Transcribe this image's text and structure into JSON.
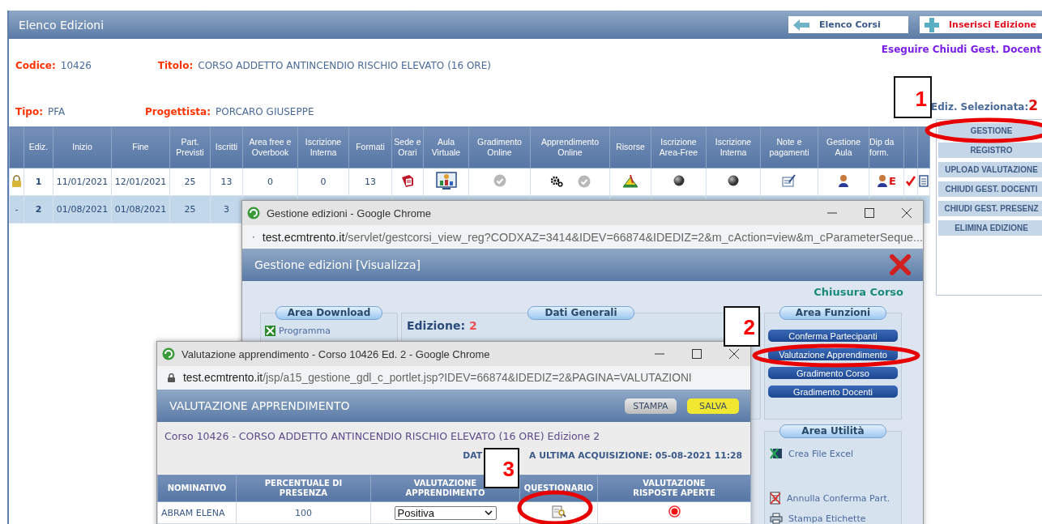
{
  "main": {
    "title": "Elenco Edizioni",
    "nav_buttons": [
      {
        "kind": "back",
        "label": "Elenco Corsi"
      },
      {
        "kind": "add",
        "label": "Inserisci Edizione"
      }
    ],
    "notice": "Eseguire Chiudi Gest. Docent",
    "fields": [
      {
        "label": "Codice:",
        "value": "10426"
      },
      {
        "label": "Titolo:",
        "value": "CORSO ADDETTO ANTINCENDIO RISCHIO ELEVATO (16 ORE)"
      },
      {
        "label": "Tipo:",
        "value": "PFA"
      },
      {
        "label": "Progettista:",
        "value": "PORCARO GIUSEPPE"
      }
    ],
    "selected_label": "Ediz. Selezionata:",
    "selected_value": "2",
    "table": {
      "columns": [
        {
          "kind": "blank"
        },
        {
          "kind": "text",
          "label": "Ediz."
        },
        {
          "kind": "text",
          "label": "Inizio"
        },
        {
          "kind": "text",
          "label": "Fine"
        },
        {
          "kind": "text",
          "label": "Part. Previsti"
        },
        {
          "kind": "text",
          "label": "Iscritti"
        },
        {
          "kind": "text",
          "label": "Area free e Overbook"
        },
        {
          "kind": "text",
          "label": "Iscrizione Interna"
        },
        {
          "kind": "text",
          "label": "Formati"
        },
        {
          "kind": "text",
          "label": "Sede e Orari"
        },
        {
          "kind": "text",
          "label": "Aula Virtuale"
        },
        {
          "kind": "text",
          "label": "Gradimento Online"
        },
        {
          "kind": "text",
          "label": "Apprendimento Online"
        },
        {
          "kind": "text",
          "label": "Risorse"
        },
        {
          "kind": "text",
          "label": "Iscrizione Area-Free"
        },
        {
          "kind": "text",
          "label": "Iscrizione Interna"
        },
        {
          "kind": "text",
          "label": "Note e pagamenti"
        },
        {
          "kind": "text",
          "label": "Gestione Aula"
        },
        {
          "kind": "text",
          "label": "Dip da form."
        },
        {
          "kind": "blank"
        },
        {
          "kind": "blank"
        }
      ],
      "rows": [
        {
          "selected": false,
          "cells": [
            {
              "kind": "icon"
            },
            {
              "kind": "text",
              "text": "1"
            },
            {
              "kind": "text",
              "text": "11/01/2021"
            },
            {
              "kind": "text",
              "text": "12/01/2021"
            },
            {
              "kind": "text",
              "text": "25"
            },
            {
              "kind": "text",
              "text": "13"
            },
            {
              "kind": "text",
              "text": "0"
            },
            {
              "kind": "text",
              "text": "0"
            },
            {
              "kind": "text",
              "text": "13"
            },
            {
              "kind": "icon"
            },
            {
              "kind": "icon"
            },
            {
              "kind": "icon"
            },
            {
              "kind": "icon"
            },
            {
              "kind": "icon"
            },
            {
              "kind": "icon"
            },
            {
              "kind": "icon"
            },
            {
              "kind": "icon"
            },
            {
              "kind": "icon"
            },
            {
              "kind": "icon",
              "text": "E"
            },
            {
              "kind": "icon"
            },
            {
              "kind": "icon"
            }
          ]
        },
        {
          "selected": true,
          "cells": [
            {
              "kind": "text",
              "text": "-"
            },
            {
              "kind": "text",
              "text": "2"
            },
            {
              "kind": "text",
              "text": "01/08/2021"
            },
            {
              "kind": "text",
              "text": "01/08/2021"
            },
            {
              "kind": "text",
              "text": "25"
            },
            {
              "kind": "text",
              "text": "3"
            }
          ]
        }
      ]
    },
    "menu": [
      "GESTIONE",
      "REGISTRO",
      "UPLOAD VALUTAZIONE",
      "CHIUDI GEST. DOCENTI",
      "CHIUDI GEST. PRESENZ",
      "ELIMINA EDIZIONE"
    ]
  },
  "window_1": {
    "title": "Gestione edizioni - Google Chrome",
    "url_host": "test.ecmtrento.it",
    "url_path": "/servlet/gestcorsi_view_reg?CODXAZ=3414&IDEV=66874&IDEDIZ=2&m_cAction=view&m_cParameterSeque...",
    "header": "Gestione edizioni [Visualizza]",
    "status": "Chiusura Corso",
    "download": {
      "title": "Area Download",
      "items": [
        "Programma"
      ]
    },
    "general": {
      "title": "Dati Generali",
      "label": "Edizione:",
      "value": "2"
    },
    "functions": {
      "title": "Area Funzioni",
      "buttons": [
        "Conferma Partecipanti",
        "Valutazione Apprendimento",
        "Gradimento Corso",
        "Gradimento Docenti"
      ]
    },
    "utilities": {
      "title": "Area Utilità",
      "items": [
        "Crea File Excel",
        "Annulla Conferma Part.",
        "Stampa Etichette"
      ]
    }
  },
  "window_2": {
    "title": "Valutazione apprendimento - Corso 10426 Ed. 2 - Google Chrome",
    "url_host": "test.ecmtrento.it",
    "url_path": "/jsp/a15_gestione_gdl_c_portlet.jsp?IDEV=66874&IDEDIZ=2&PAGINA=VALUTAZIONI",
    "header": "VALUTAZIONE APPRENDIMENTO",
    "buttons": [
      {
        "kind": "print",
        "label": "STAMPA"
      },
      {
        "kind": "save",
        "label": "SALVA"
      }
    ],
    "course": "Corso 10426 - CORSO ADDETTO ANTINCENDIO RISCHIO ELEVATO (16 ORE) Edizione 2",
    "acquisition": [
      "DAT",
      "A ULTIMA ACQUISIZIONE: 05-08-2021 11:28"
    ],
    "table": {
      "columns": [
        "NOMINATIVO",
        "PERCENTUALE DI PRESENZA",
        "VALUTAZIONE APPRENDIMENTO",
        "QUESTIONARIO",
        "VALUTAZIONE RISPOSTE APERTE"
      ],
      "rows": [
        {
          "name": "ABRAM ELENA",
          "presence": "100",
          "evaluation": "Positiva"
        }
      ]
    }
  },
  "annotations": [
    {
      "text": "1"
    },
    {
      "text": "2"
    },
    {
      "text": "3"
    }
  ]
}
